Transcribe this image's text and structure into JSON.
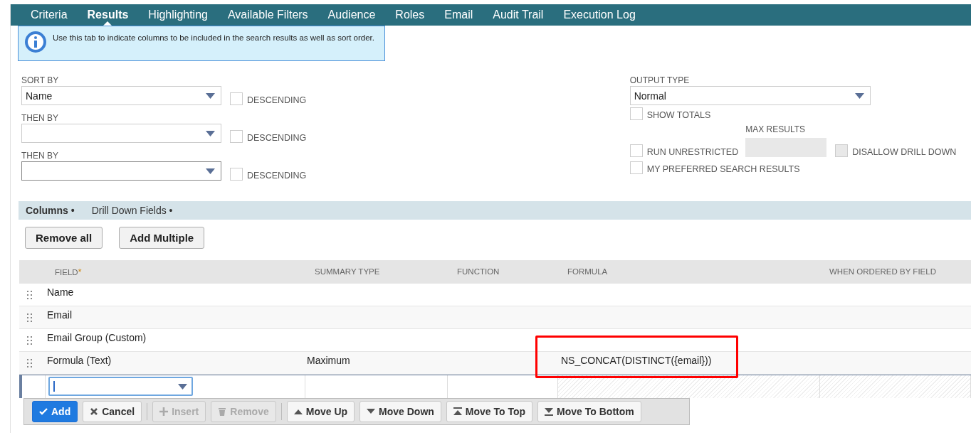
{
  "tabs": [
    {
      "label": "Criteria",
      "selected": false
    },
    {
      "label": "Results",
      "selected": true
    },
    {
      "label": "Highlighting",
      "selected": false
    },
    {
      "label": "Available Filters",
      "selected": false
    },
    {
      "label": "Audience",
      "selected": false
    },
    {
      "label": "Roles",
      "selected": false
    },
    {
      "label": "Email",
      "selected": false
    },
    {
      "label": "Audit Trail",
      "selected": false
    },
    {
      "label": "Execution Log",
      "selected": false
    }
  ],
  "info": "Use this tab to indicate columns to be included in the search results as well as sort order.",
  "sort": [
    {
      "label": "SORT BY",
      "value": "Name",
      "descending_label": "DESCENDING",
      "descending": false
    },
    {
      "label": "THEN BY",
      "descending_label": "DESCENDING",
      "descending": false
    },
    {
      "label": "THEN BY",
      "descending_label": "DESCENDING",
      "descending": false
    }
  ],
  "output_type": {
    "label": "OUTPUT TYPE",
    "value": "Normal"
  },
  "show_totals": {
    "label": "SHOW TOTALS",
    "checked": false
  },
  "max_results": {
    "label": "MAX RESULTS",
    "disabled": true
  },
  "run_unrestricted": {
    "label": "RUN UNRESTRICTED",
    "checked": false
  },
  "disallow_drill_down": {
    "label": "DISALLOW DRILL DOWN",
    "checked": false,
    "disabled": true
  },
  "my_preferred": {
    "label": "MY PREFERRED SEARCH RESULTS",
    "checked": false
  },
  "subtabs": [
    {
      "label": "Columns",
      "marker": "•",
      "selected": true
    },
    {
      "label": "Drill Down Fields",
      "marker": "•",
      "selected": false
    }
  ],
  "buttons": [
    "Remove all",
    "Add Multiple"
  ],
  "columns": [
    {
      "label": "FIELD",
      "required_mark": "*"
    },
    {
      "label": "SUMMARY TYPE"
    },
    {
      "label": "FUNCTION"
    },
    {
      "label": "FORMULA"
    },
    {
      "label": "WHEN ORDERED BY FIELD"
    }
  ],
  "rows": [
    {
      "cells": [
        "Name"
      ]
    },
    {
      "cells": [
        "Email"
      ]
    },
    {
      "cells": [
        "Email Group (Custom)"
      ]
    },
    {
      "cells": [
        "Formula (Text)",
        "Maximum",
        "",
        "NS_CONCAT(DISTINCT({email}))"
      ]
    }
  ],
  "toolbar": [
    [
      {
        "label": "Add",
        "kind": "add",
        "disabled": false
      },
      {
        "label": "Cancel",
        "kind": "cancel",
        "disabled": false
      }
    ],
    [
      {
        "label": "Insert",
        "kind": "insert",
        "disabled": true
      },
      {
        "label": "Remove",
        "kind": "remove",
        "disabled": true
      }
    ],
    [
      {
        "label": "Move Up",
        "kind": "up",
        "disabled": false
      },
      {
        "label": "Move Down",
        "kind": "down",
        "disabled": false
      },
      {
        "label": "Move To Top",
        "kind": "top",
        "disabled": false
      },
      {
        "label": "Move To Bottom",
        "kind": "bottom",
        "disabled": false
      }
    ]
  ]
}
